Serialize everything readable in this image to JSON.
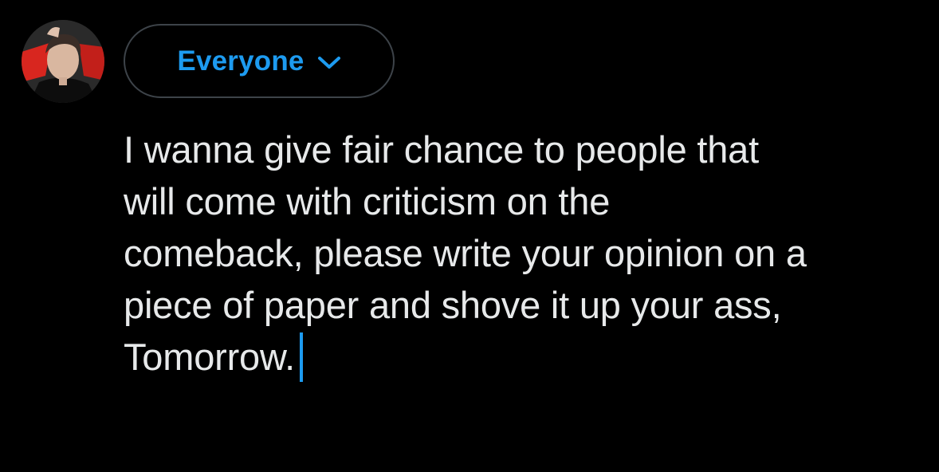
{
  "audience": {
    "label": "Everyone",
    "icon": "chevron-down-icon",
    "accent_color": "#1d9bf0"
  },
  "avatar": {
    "icon": "user-avatar"
  },
  "composer": {
    "lines": [
      "I wanna give fair chance to people that",
      "will come with criticism on the",
      "comeback, please write your opinion on a",
      "piece of paper and shove it up your ass,",
      "Tomorrow."
    ],
    "text_color": "#e7e9ea",
    "caret_color": "#1d9bf0"
  },
  "theme": {
    "background": "#000000",
    "border": "#3d4349"
  }
}
